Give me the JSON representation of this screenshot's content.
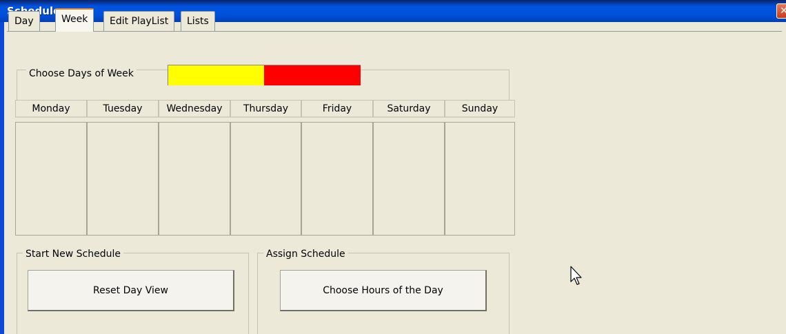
{
  "window": {
    "title": "Scheduler",
    "close_glyph": "✕"
  },
  "tabs": [
    {
      "label": "Day",
      "active": false
    },
    {
      "label": "Week",
      "active": true
    },
    {
      "label": "Edit PlayList",
      "active": false
    },
    {
      "label": "Lists",
      "active": false
    }
  ],
  "choose_days": {
    "label": "Choose Days of Week",
    "color_bar": [
      "#ffff00",
      "#ff0000"
    ]
  },
  "days": [
    "Monday",
    "Tuesday",
    "Wednesday",
    "Thursday",
    "Friday",
    "Saturday",
    "Sunday"
  ],
  "start_new_schedule": {
    "label": "Start New Schedule",
    "button": "Reset Day View"
  },
  "assign_schedule": {
    "label": "Assign Schedule",
    "button": "Choose Hours of the Day"
  },
  "icons": {
    "cursor": "mouse-pointer-icon",
    "close": "close-icon"
  }
}
